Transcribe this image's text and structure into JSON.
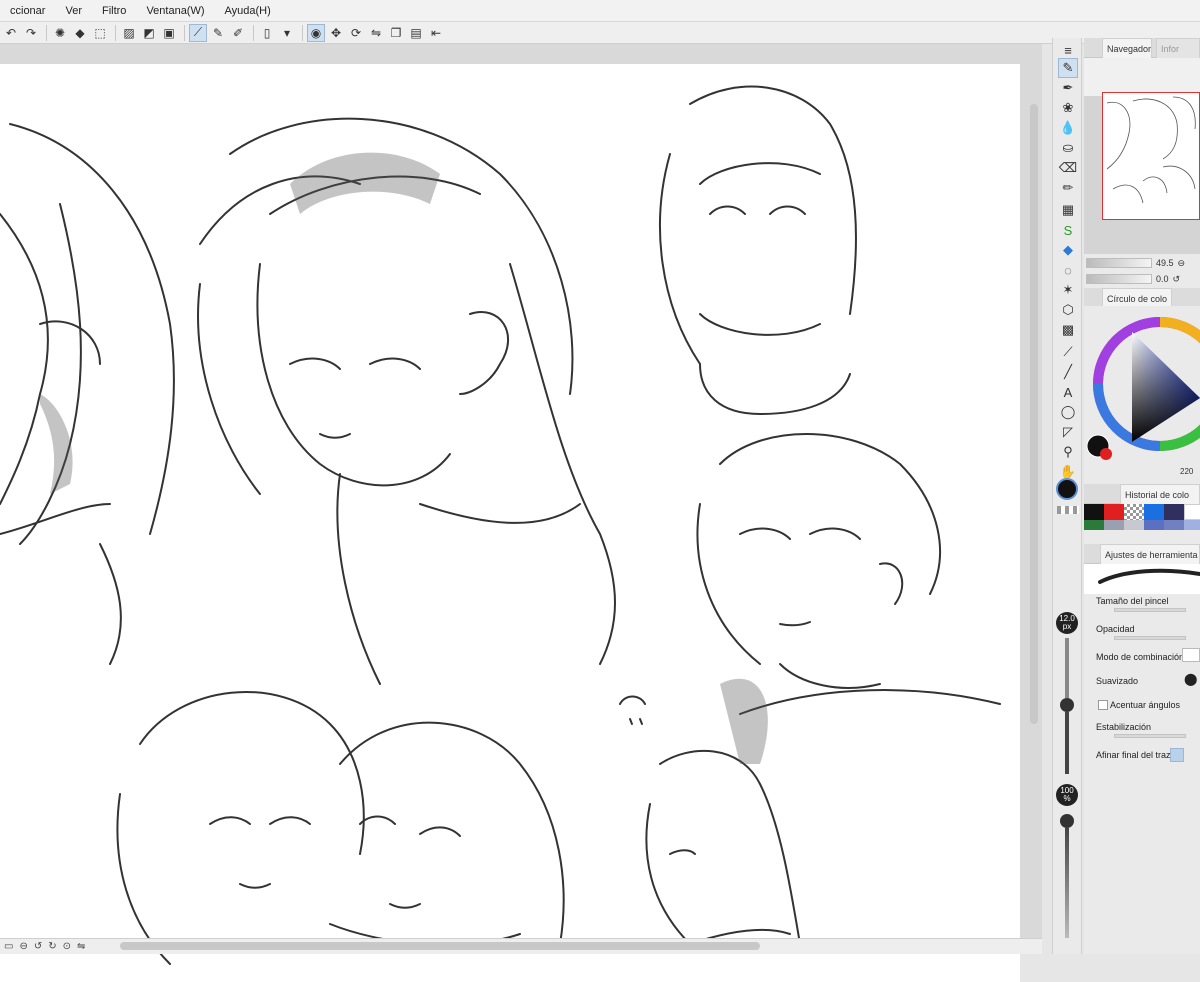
{
  "menu": [
    "ccionar",
    "Ver",
    "Filtro",
    "Ventana(W)",
    "Ayuda(H)"
  ],
  "toolbar_icons": [
    "undo-icon",
    "redo-icon",
    "lasso-icon",
    "fill-icon",
    "transform-icon",
    "grid-icon",
    "ruler-icon",
    "brush-icon",
    "pen-icon",
    "pen2-icon",
    "phone-icon",
    "select-icon",
    "move-icon",
    "rotate-icon",
    "flip-icon",
    "layer-icon",
    "export-icon"
  ],
  "tools": [
    "pen-icon",
    "marker-icon",
    "rabbit-icon",
    "drop-icon",
    "ink-icon",
    "eraser-icon",
    "pencil-icon",
    "frame-icon",
    "s-icon",
    "paint-bucket-icon",
    "lasso-icon",
    "sparkle-icon",
    "cube-icon",
    "gradient-icon",
    "eyedropper-icon",
    "line-icon",
    "text-icon",
    "balloon-icon",
    "shape-icon",
    "eyedrop2-icon",
    "hand-icon"
  ],
  "navigator": {
    "tab": "Navegador",
    "tab2": "Infor",
    "zoom": "49.5",
    "rotate": "0.0"
  },
  "colorwheel": {
    "tab": "Círculo de colo",
    "value": "220"
  },
  "history": {
    "tab": "Historial de colo"
  },
  "toolsettings": {
    "tab": "Ajustes de herramienta",
    "rows": [
      "Tamaño del pincel",
      "Opacidad",
      "Modo de combinación",
      "Suavizado",
      "Acentuar ángulos",
      "Estabilización",
      "Afinar final del trazo"
    ]
  },
  "brush_size": "12.0\npx",
  "opacity": "100\n%",
  "colors": {
    "main": "#111111",
    "sub": "#e02020",
    "accent": "#5b8fd6"
  }
}
